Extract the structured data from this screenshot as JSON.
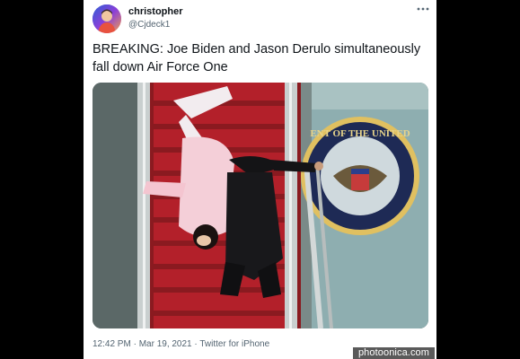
{
  "tweet": {
    "display_name": "christopher",
    "handle": "@Cjdeck1",
    "text": "BREAKING: Joe Biden and Jason Derulo simultaneously fall down Air Force One",
    "timestamp": "12:42 PM · Mar 19, 2021",
    "separator": " · ",
    "source": "Twitter for iPhone",
    "more_icon": "more-horizontal-icon",
    "avatar": "profile-avatar"
  },
  "media": {
    "description_icon": "photo",
    "seal_text": "ENT OF THE UNITED STATES"
  },
  "watermark": {
    "text": "photoonica.com"
  },
  "colors": {
    "text_primary": "#0f1419",
    "text_secondary": "#536471",
    "background": "#000000",
    "card": "#ffffff",
    "stair_red": "#b3202a"
  }
}
